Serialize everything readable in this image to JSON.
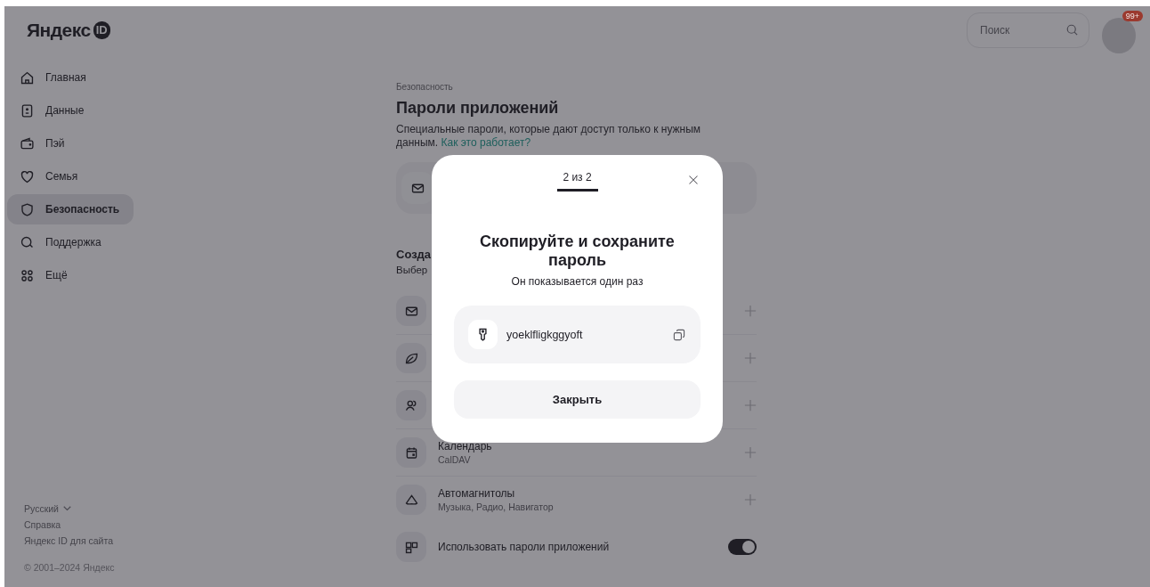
{
  "logo": {
    "text": "Яндекс",
    "badge": "ID"
  },
  "nav": [
    {
      "label": "Главная",
      "selected": false
    },
    {
      "label": "Данные",
      "selected": false
    },
    {
      "label": "Пэй",
      "selected": false
    },
    {
      "label": "Семья",
      "selected": false
    },
    {
      "label": "Безопасность",
      "selected": true
    },
    {
      "label": "Поддержка",
      "selected": false
    },
    {
      "label": "Ещё",
      "selected": false
    }
  ],
  "footer": {
    "language": "Русский",
    "links": [
      "Справка",
      "Яндекс ID для сайта"
    ],
    "copyright": "© 2001–2024 Яндекс"
  },
  "search": {
    "placeholder": "Поиск"
  },
  "avatar": {
    "badge": "99+"
  },
  "breadcrumb": "Безопасность",
  "title": "Пароли приложений",
  "description": "Специальные пароли, которые дают доступ только к нужным данным.",
  "link": "Как это работает?",
  "section": {
    "title": "Созда",
    "subtitle": "Выбер"
  },
  "apps": [
    {
      "name": "Календарь",
      "detail": "CalDAV"
    },
    {
      "name": "Автомагнитолы",
      "detail": "Музыка, Радио, Навигатор"
    }
  ],
  "toggle_row": {
    "label": "Использовать пароли приложений",
    "on": true
  },
  "modal": {
    "step": "2 из 2",
    "title": "Скопируйте и сохраните пароль",
    "subtitle": "Он показывается один раз",
    "password": "yoeklfligkggyoft",
    "button": "Закрыть"
  }
}
